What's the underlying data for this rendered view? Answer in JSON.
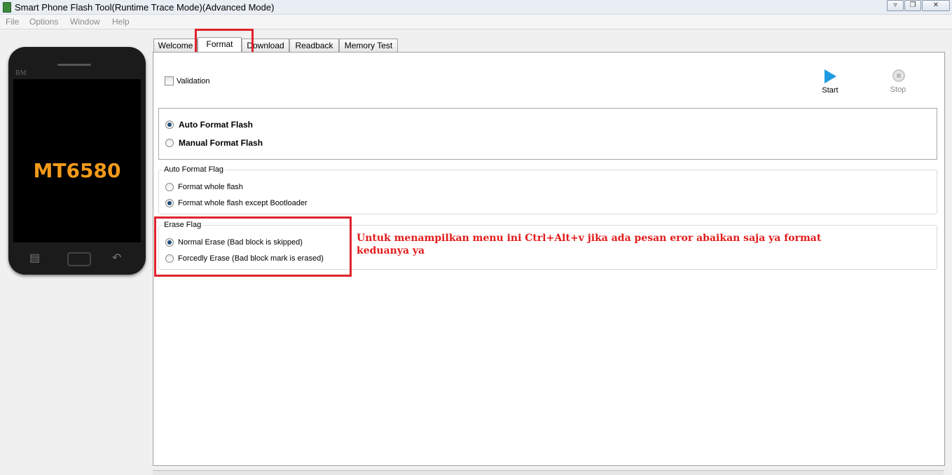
{
  "window": {
    "title": "Smart Phone Flash Tool(Runtime Trace Mode)(Advanced Mode)",
    "controls": [
      "minimize-icon",
      "restore-icon",
      "close-icon"
    ]
  },
  "menu": {
    "items": [
      "File",
      "Options",
      "Window",
      "Help"
    ]
  },
  "phone": {
    "brand": "BM",
    "model": "MT6580"
  },
  "tabs": [
    "Welcome",
    "Format",
    "Download",
    "Readback",
    "Memory Test"
  ],
  "active_tab": "Format",
  "format": {
    "validation_label": "Validation",
    "start_label": "Start",
    "stop_label": "Stop",
    "mode_options": [
      "Auto Format Flash",
      "Manual Format Flash"
    ],
    "auto_flag": {
      "title": "Auto Format Flag",
      "options": [
        "Format whole flash",
        "Format whole flash except Bootloader"
      ]
    },
    "erase_flag": {
      "title": "Erase Flag",
      "options": [
        "Normal Erase (Bad block is skipped)",
        "Forcedly Erase (Bad block mark is erased)"
      ]
    }
  },
  "annotation": "Untuk menampilkan menu ini Ctrl+Alt+v jika ada pesan eror abaikan saja ya format keduanya  ya",
  "colors": {
    "annotation": "#e21b1b",
    "highlight_frame": "#e0222b",
    "start_icon": "#1e9be0",
    "phone_model": "#f29a1a"
  }
}
